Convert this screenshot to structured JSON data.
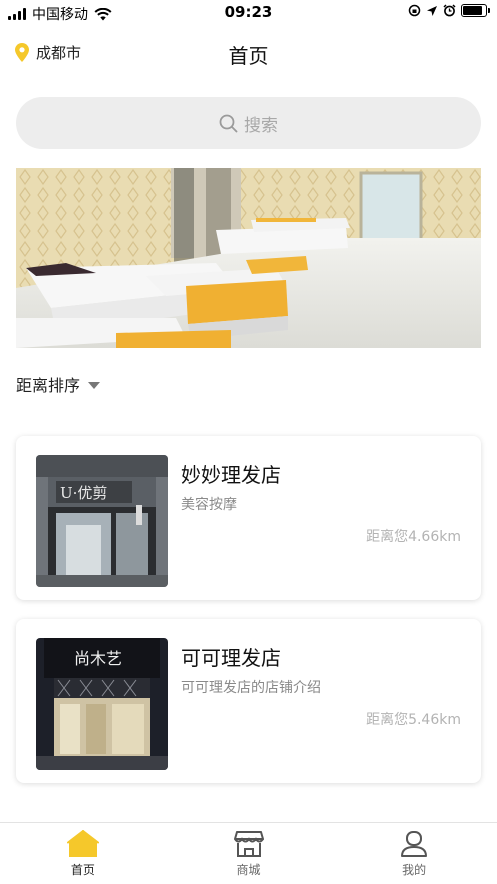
{
  "status_bar": {
    "carrier": "中国移动",
    "time": "09:23"
  },
  "header": {
    "city": "成都市",
    "title": "首页"
  },
  "search": {
    "label": "搜索"
  },
  "sort": {
    "label": "距离排序"
  },
  "shops": [
    {
      "name": "妙妙理发店",
      "desc": "美容按摩",
      "distance": "距离您4.66km"
    },
    {
      "name": "可可理发店",
      "desc": "可可理发店的店铺介绍",
      "distance": "距离您5.46km"
    }
  ],
  "tabbar": {
    "items": [
      {
        "label": "首页",
        "icon": "home-icon",
        "active": true
      },
      {
        "label": "商城",
        "icon": "store-icon",
        "active": false
      },
      {
        "label": "我的",
        "icon": "profile-icon",
        "active": false
      }
    ]
  },
  "colors": {
    "accent": "#f5c82b",
    "search_bg": "#ededed"
  }
}
